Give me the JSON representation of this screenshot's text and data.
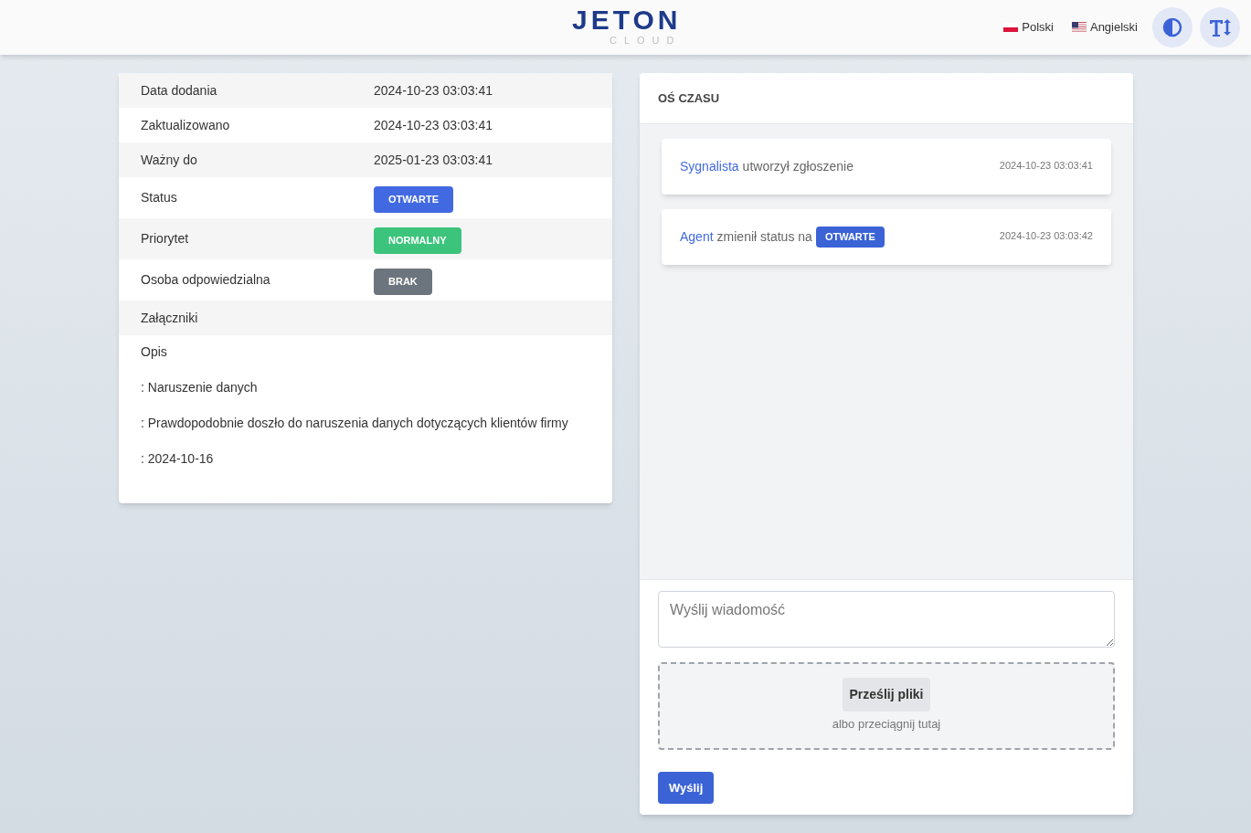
{
  "header": {
    "logo": {
      "title": "JETON",
      "subtitle": "CLOUD"
    },
    "languages": [
      {
        "label": "Polski",
        "kind": "pl"
      },
      {
        "label": "Angielski",
        "kind": "us"
      }
    ]
  },
  "details": {
    "rows": [
      {
        "label": "Data dodania",
        "kind": "text",
        "value": "2024-10-23 03:03:41"
      },
      {
        "label": "Zaktualizowano",
        "kind": "text",
        "value": "2024-10-23 03:03:41"
      },
      {
        "label": "Ważny do",
        "kind": "text",
        "value": "2025-01-23 03:03:41"
      },
      {
        "label": "Status",
        "kind": "badge",
        "value": "OTWARTE",
        "color": "#4169e1"
      },
      {
        "label": "Priorytet",
        "kind": "badge",
        "value": "NORMALNY",
        "color": "#3cc47c"
      },
      {
        "label": "Osoba odpowiedzialna",
        "kind": "badge",
        "value": "BRAK",
        "color": "#6c757d"
      },
      {
        "label": "Załączniki",
        "kind": "empty"
      }
    ],
    "description_title": "Opis",
    "description_lines": [
      ": Naruszenie danych",
      ": Prawdopodobnie doszło do naruszenia danych dotyczących klientów firmy",
      ": 2024-10-16"
    ]
  },
  "timeline": {
    "title": "OŚ CZASU",
    "events": [
      {
        "actor": "Sygnalista",
        "text": "utworzył zgłoszenie",
        "time": "2024-10-23 03:03:41"
      },
      {
        "actor": "Agent",
        "text": "zmienił status na",
        "badge": "OTWARTE",
        "time": "2024-10-23 03:03:42"
      }
    ],
    "message": {
      "placeholder": "Wyślij wiadomość"
    },
    "upload": {
      "button": "Prześlij pliki",
      "hint": "albo przeciągnij tutaj"
    },
    "send": "Wyślij"
  }
}
